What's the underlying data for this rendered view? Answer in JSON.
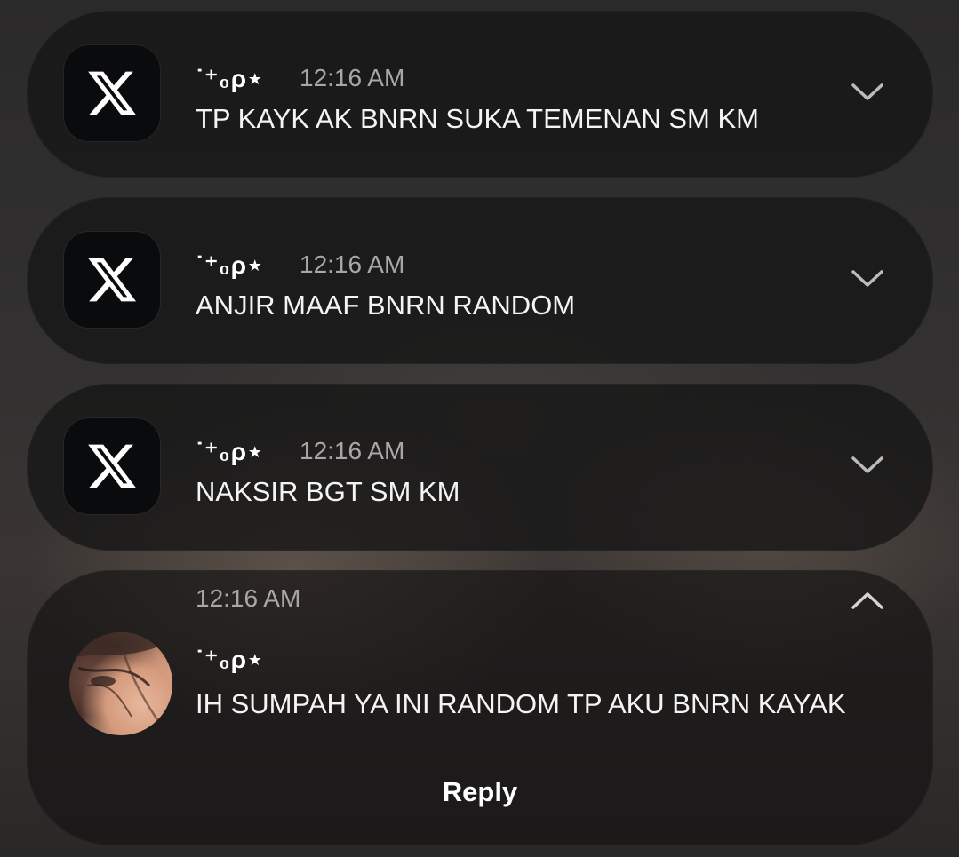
{
  "notifications": [
    {
      "app_icon": "x-logo-icon",
      "sender": "˙⁺₀ρ⋆",
      "time": "12:16 AM",
      "message": "TP KAYK AK BNRN SUKA TEMENAN SM KM",
      "chevron": "chevron-down-icon"
    },
    {
      "app_icon": "x-logo-icon",
      "sender": "˙⁺₀ρ⋆",
      "time": "12:16 AM",
      "message": "ANJIR MAAF BNRN RANDOM",
      "chevron": "chevron-down-icon"
    },
    {
      "app_icon": "x-logo-icon",
      "sender": "˙⁺₀ρ⋆",
      "time": "12:16 AM",
      "message": "NAKSIR BGT SM KM",
      "chevron": "chevron-down-icon"
    }
  ],
  "expanded": {
    "time": "12:16 AM",
    "sender": "˙⁺₀ρ⋆",
    "message": "IH SUMPAH YA INI RANDOM TP AKU BNRN KAYAK",
    "reply_label": "Reply",
    "avatar": "avatar-photo",
    "chevron": "chevron-up-icon"
  },
  "colors": {
    "card_bg": "#161617",
    "text_primary": "#f4f4f4",
    "text_secondary": "#a9a7a6"
  }
}
